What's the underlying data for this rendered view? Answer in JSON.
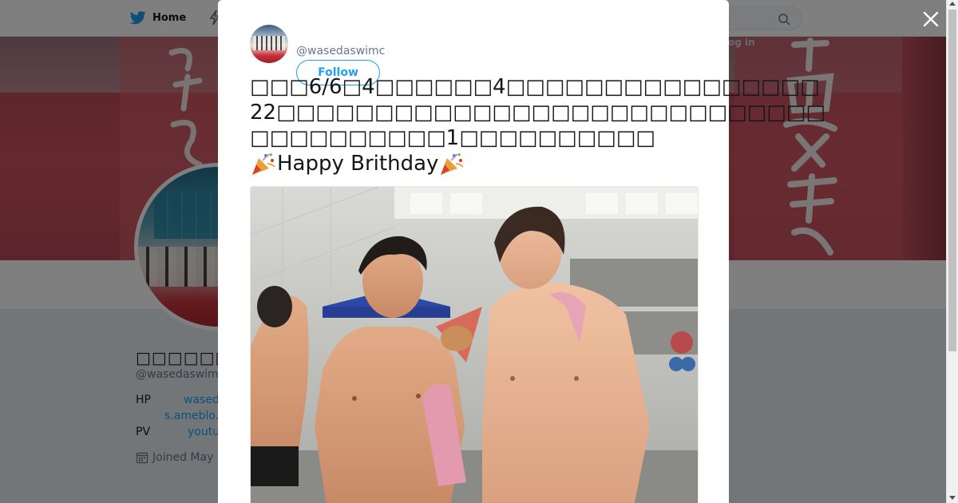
{
  "nav": {
    "home_label": "Home",
    "login_label": "og in"
  },
  "profile": {
    "name": "□□□□□□□□□□",
    "handle": "@wasedaswim",
    "bio": {
      "hp_label": "HP",
      "hp_link_1": "wased",
      "hp_link_2": "s.ameblo.",
      "pv_label": "PV",
      "pv_link": "youtu"
    },
    "joined": "Joined May"
  },
  "tweet": {
    "handle": "@wasedaswimc",
    "follow_label": "Follow",
    "lines": [
      "□□□6/6□4□□□□□□4□□□□□□□□□□□□□□□□",
      "22□□□□□□□□□□□□□□□□□□□□□□□□□□□□",
      "□□□□□□□□□□1□□□□□□□□□□",
      "Happy Brithday"
    ]
  },
  "icons": {
    "home": "twitter-bird-icon",
    "moments": "lightning-icon",
    "search": "search-icon",
    "close": "close-icon",
    "calendar": "calendar-icon",
    "party": "party-popper-icon"
  },
  "colors": {
    "accent": "#1da1f2",
    "banner": "#c9525e",
    "overlay": "rgba(0,0,0,0.5)"
  }
}
